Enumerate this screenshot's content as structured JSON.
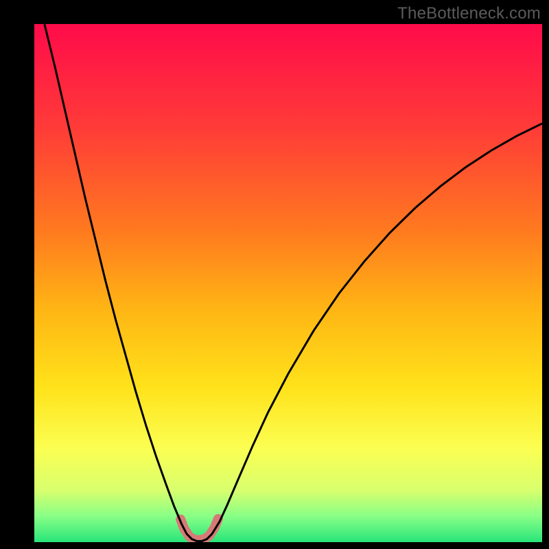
{
  "watermark": "TheBottleneck.com",
  "chart_data": {
    "type": "line",
    "title": "",
    "xlabel": "",
    "ylabel": "",
    "xlim": [
      0,
      100
    ],
    "ylim": [
      0,
      100
    ],
    "background_gradient": {
      "direction": "vertical",
      "stops": [
        {
          "pos": 0.0,
          "color": "#ff0b4a"
        },
        {
          "pos": 0.2,
          "color": "#ff3b38"
        },
        {
          "pos": 0.4,
          "color": "#ff7a1f"
        },
        {
          "pos": 0.55,
          "color": "#ffb514"
        },
        {
          "pos": 0.7,
          "color": "#ffe21a"
        },
        {
          "pos": 0.82,
          "color": "#fbff52"
        },
        {
          "pos": 0.9,
          "color": "#d8ff6e"
        },
        {
          "pos": 0.95,
          "color": "#88ff86"
        },
        {
          "pos": 1.0,
          "color": "#28e57a"
        }
      ]
    },
    "series": [
      {
        "name": "bottleneck-curve",
        "color": "#000000",
        "stroke_width": 3,
        "points": [
          {
            "x": 2.0,
            "y": 100.0
          },
          {
            "x": 4.0,
            "y": 92.0
          },
          {
            "x": 6.0,
            "y": 83.5
          },
          {
            "x": 8.0,
            "y": 75.0
          },
          {
            "x": 10.0,
            "y": 66.5
          },
          {
            "x": 12.0,
            "y": 58.5
          },
          {
            "x": 14.0,
            "y": 50.5
          },
          {
            "x": 16.0,
            "y": 43.0
          },
          {
            "x": 18.0,
            "y": 36.0
          },
          {
            "x": 20.0,
            "y": 29.0
          },
          {
            "x": 22.0,
            "y": 22.5
          },
          {
            "x": 24.0,
            "y": 16.5
          },
          {
            "x": 26.0,
            "y": 11.0
          },
          {
            "x": 27.5,
            "y": 7.0
          },
          {
            "x": 29.0,
            "y": 3.5
          },
          {
            "x": 30.0,
            "y": 1.6
          },
          {
            "x": 31.0,
            "y": 0.6
          },
          {
            "x": 32.0,
            "y": 0.2
          },
          {
            "x": 33.0,
            "y": 0.2
          },
          {
            "x": 34.0,
            "y": 0.6
          },
          {
            "x": 35.0,
            "y": 1.6
          },
          {
            "x": 36.5,
            "y": 4.0
          },
          {
            "x": 38.0,
            "y": 7.2
          },
          {
            "x": 40.0,
            "y": 11.8
          },
          {
            "x": 43.0,
            "y": 18.6
          },
          {
            "x": 46.0,
            "y": 25.0
          },
          {
            "x": 50.0,
            "y": 32.5
          },
          {
            "x": 55.0,
            "y": 40.8
          },
          {
            "x": 60.0,
            "y": 48.0
          },
          {
            "x": 65.0,
            "y": 54.2
          },
          {
            "x": 70.0,
            "y": 59.7
          },
          {
            "x": 75.0,
            "y": 64.5
          },
          {
            "x": 80.0,
            "y": 68.7
          },
          {
            "x": 85.0,
            "y": 72.4
          },
          {
            "x": 90.0,
            "y": 75.6
          },
          {
            "x": 95.0,
            "y": 78.4
          },
          {
            "x": 100.0,
            "y": 80.8
          }
        ]
      },
      {
        "name": "optimal-highlight",
        "color": "#d77a77",
        "stroke_width": 14,
        "stroke_linecap": "round",
        "points": [
          {
            "x": 28.8,
            "y": 4.4
          },
          {
            "x": 29.5,
            "y": 2.6
          },
          {
            "x": 30.5,
            "y": 1.1
          },
          {
            "x": 31.5,
            "y": 0.5
          },
          {
            "x": 32.5,
            "y": 0.4
          },
          {
            "x": 33.5,
            "y": 0.6
          },
          {
            "x": 34.5,
            "y": 1.3
          },
          {
            "x": 35.5,
            "y": 2.8
          },
          {
            "x": 36.2,
            "y": 4.5
          }
        ]
      }
    ],
    "annotations": []
  }
}
